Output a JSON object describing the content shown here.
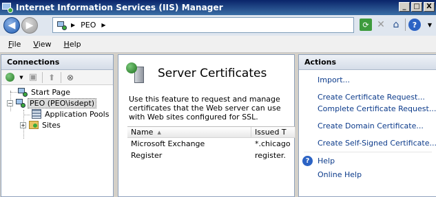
{
  "window": {
    "title": "Internet Information Services (IIS) Manager",
    "controls": {
      "minimize": "_",
      "maximize": "□",
      "close": "X"
    }
  },
  "address": {
    "breadcrumb": [
      "PEO"
    ],
    "separator": "▶"
  },
  "toolbar": {
    "icons": [
      "refresh-icon",
      "stop-icon",
      "home-icon",
      "help-icon"
    ]
  },
  "menu": [
    {
      "label": "File",
      "mnemonic": "F",
      "rest": "ile"
    },
    {
      "label": "View",
      "mnemonic": "V",
      "rest": "iew"
    },
    {
      "label": "Help",
      "mnemonic": "H",
      "rest": "elp"
    }
  ],
  "connections": {
    "title": "Connections",
    "tree": {
      "start_page": "Start Page",
      "server": "PEO (PEO\\isdept)",
      "app_pools": "Application Pools",
      "sites": "Sites",
      "server_expander": "−",
      "sites_expander": "+"
    }
  },
  "feature": {
    "title": "Server Certificates",
    "description": "Use this feature to request and manage certificates that the Web server can use with Web sites configured for SSL.",
    "columns": {
      "name": "Name",
      "issued": "Issued T"
    },
    "rows": [
      {
        "name": "Microsoft Exchange",
        "issued": "*.chicago"
      },
      {
        "name": "Register",
        "issued": "register."
      }
    ]
  },
  "actions": {
    "title": "Actions",
    "import": "Import...",
    "create_request": "Create Certificate Request...",
    "complete_request": "Complete Certificate Request...",
    "create_domain": "Create Domain Certificate...",
    "create_self_signed": "Create Self-Signed Certificate...",
    "help": "Help",
    "online_help": "Online Help"
  }
}
